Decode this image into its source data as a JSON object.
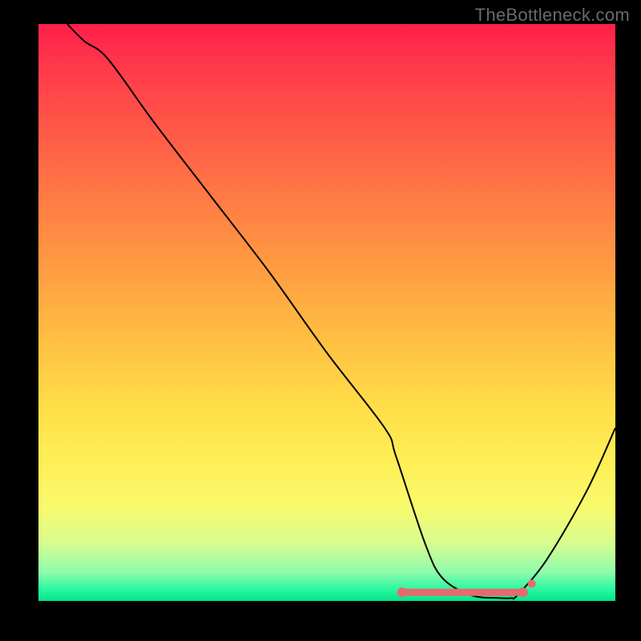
{
  "watermark": "TheBottleneck.com",
  "chart_data": {
    "type": "line",
    "title": "",
    "xlabel": "",
    "ylabel": "",
    "xlim": [
      0,
      100
    ],
    "ylim": [
      0,
      100
    ],
    "series": [
      {
        "name": "curve",
        "x": [
          5,
          8,
          12,
          20,
          30,
          40,
          50,
          60,
          62,
          67,
          70,
          75,
          80,
          82,
          83,
          88,
          95,
          100
        ],
        "values": [
          100,
          97,
          94,
          83,
          70,
          57,
          43,
          30,
          25,
          10,
          4,
          1,
          0.5,
          0.5,
          1,
          7,
          19,
          30
        ]
      }
    ],
    "annotations": [
      {
        "type": "flat_band",
        "x_start": 63,
        "x_end": 84,
        "y": 1.5,
        "color": "#e76a6e"
      }
    ],
    "colors": {
      "curve": "#000000",
      "flat_band": "#e76a6e",
      "background_top": "#ff1f4a",
      "background_bottom": "#00e58a"
    }
  }
}
